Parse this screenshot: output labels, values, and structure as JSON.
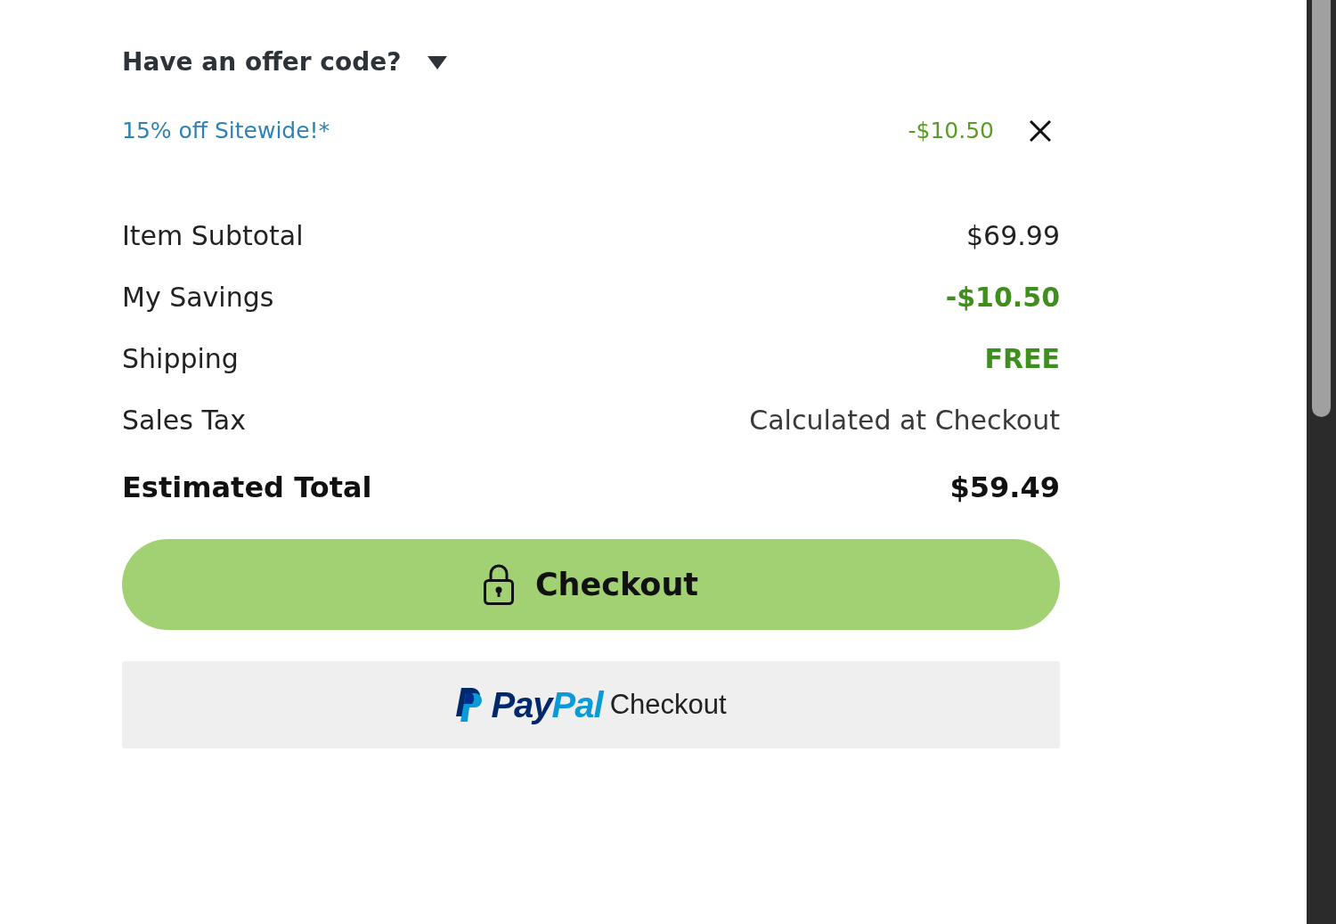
{
  "offer_code": {
    "toggle_label": "Have an offer code?",
    "applied_offers": [
      {
        "label": "15% off Sitewide!*",
        "amount": "-$10.50"
      }
    ]
  },
  "summary": {
    "rows": [
      {
        "label": "Item Subtotal",
        "value": "$69.99",
        "kind": "plain"
      },
      {
        "label": "My Savings",
        "value": "-$10.50",
        "kind": "savings"
      },
      {
        "label": "Shipping",
        "value": "FREE",
        "kind": "savings"
      },
      {
        "label": "Sales Tax",
        "value": "Calculated at Checkout",
        "kind": "note"
      }
    ],
    "total": {
      "label": "Estimated Total",
      "value": "$59.49"
    }
  },
  "checkout_button": {
    "label": "Checkout"
  },
  "paypal_button": {
    "logo_parts": [
      "Pay",
      "Pal"
    ],
    "label": "Checkout"
  }
}
